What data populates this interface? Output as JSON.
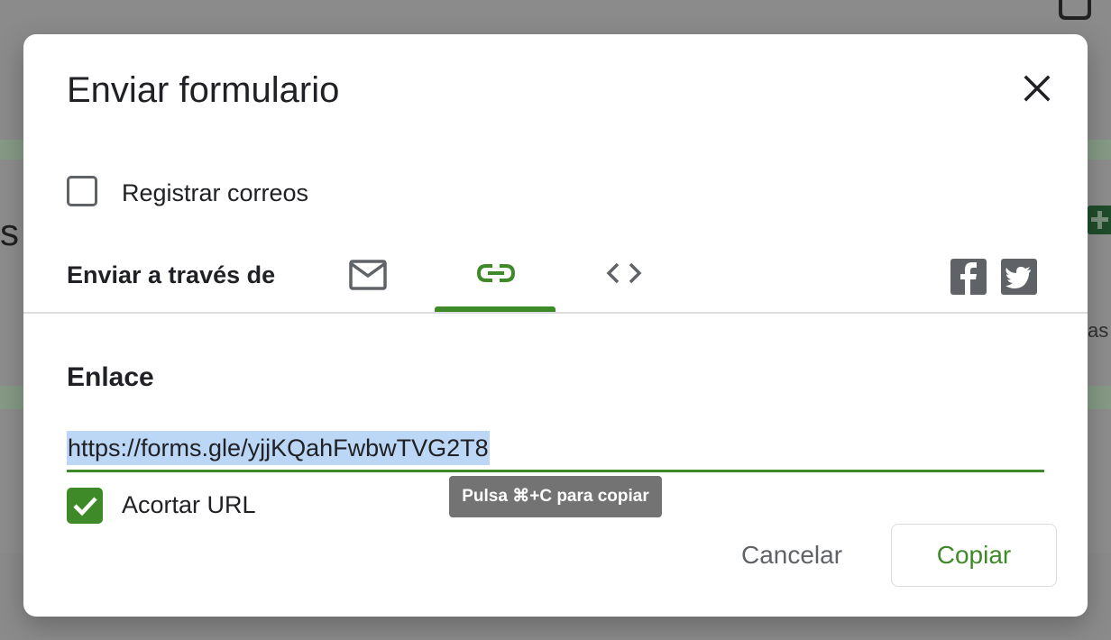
{
  "background": {
    "fragment_left": "s",
    "fragment_right": "as"
  },
  "dialog": {
    "title": "Enviar formulario",
    "collect_emails_label": "Registrar correos",
    "collect_emails_checked": false,
    "send_via_label": "Enviar a través de",
    "tabs": [
      {
        "icon": "email-icon",
        "active": false
      },
      {
        "icon": "link-icon",
        "active": true
      },
      {
        "icon": "embed-code-icon",
        "active": false
      }
    ],
    "social": [
      "facebook-icon",
      "twitter-icon"
    ],
    "link_section_title": "Enlace",
    "link_url": "https://forms.gle/yjjKQahFwbwTVG2T8",
    "tooltip": "Pulsa ⌘+C para copiar",
    "shorten_url_label": "Acortar URL",
    "shorten_url_checked": true,
    "cancel_label": "Cancelar",
    "copy_label": "Copiar"
  },
  "colors": {
    "accent": "#3f8a28",
    "icon_gray": "#5f6368",
    "selection": "#bcd6f6"
  }
}
